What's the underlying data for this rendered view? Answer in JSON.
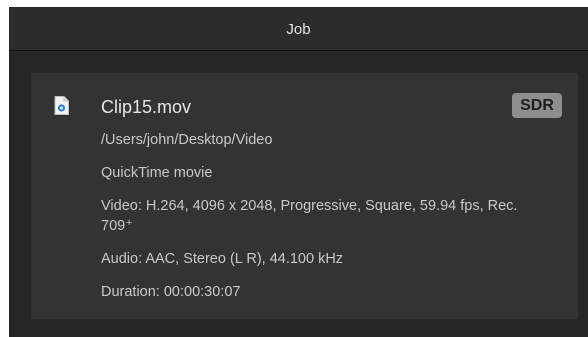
{
  "header": {
    "title": "Job"
  },
  "job": {
    "file_icon": "movie-file-icon",
    "file_name": "Clip15.mov",
    "badge": "SDR",
    "path": "/Users/john/Desktop/Video",
    "type": "QuickTime movie",
    "video": "Video: H.264, 4096 x 2048, Progressive, Square, 59.94 fps, Rec. 709⁺",
    "audio": "Audio: AAC, Stereo (L R), 44.100 kHz",
    "duration": "Duration: 00:00:30:07"
  },
  "colors": {
    "window_background": "#262626",
    "card_background": "#333333",
    "badge_background": "#8e8e8e",
    "icon_accent": "#2f7fd4"
  }
}
